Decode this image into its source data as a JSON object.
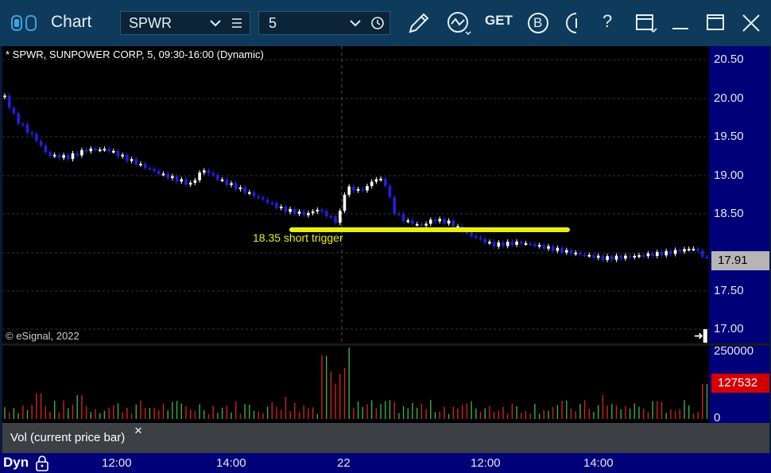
{
  "window": {
    "title": "Chart",
    "symbol": "SPWR",
    "interval": "5"
  },
  "toolbar": {
    "icons": [
      "menu-lines-icon",
      "clock-icon",
      "pencil-icon",
      "study-icon",
      "get-icon",
      "b-icon",
      "partial-circle-icon",
      "help-icon",
      "template-icon",
      "minimize-icon",
      "maximize-icon",
      "close-icon"
    ],
    "get_label": "GET",
    "b_label": "B",
    "help_label": "?"
  },
  "chart": {
    "header": "* SPWR, SUNPOWER CORP, 5, 09:30-16:00 (Dynamic)",
    "copyright": "© eSignal, 2022",
    "annotation": "18.35 short trigger",
    "current_price": "17.91",
    "current_volume": "127532",
    "price_ticks": [
      "20.50",
      "20.00",
      "19.50",
      "19.00",
      "18.50",
      "17.50",
      "17.00"
    ],
    "volume_ticks": [
      "250000",
      "0"
    ],
    "colors": {
      "up": "#ffffff",
      "down": "#2020e0",
      "trigger": "#e8f00a",
      "vol_up": "#3cb043",
      "vol_down": "#d42020",
      "axis_bg": "#000079"
    }
  },
  "legend": {
    "label": "Vol (current price bar)",
    "close_glyph": "×"
  },
  "time_axis": {
    "mode": "Dyn",
    "labels": [
      "12:00",
      "14:00",
      "22",
      "12:00",
      "14:00"
    ]
  }
}
